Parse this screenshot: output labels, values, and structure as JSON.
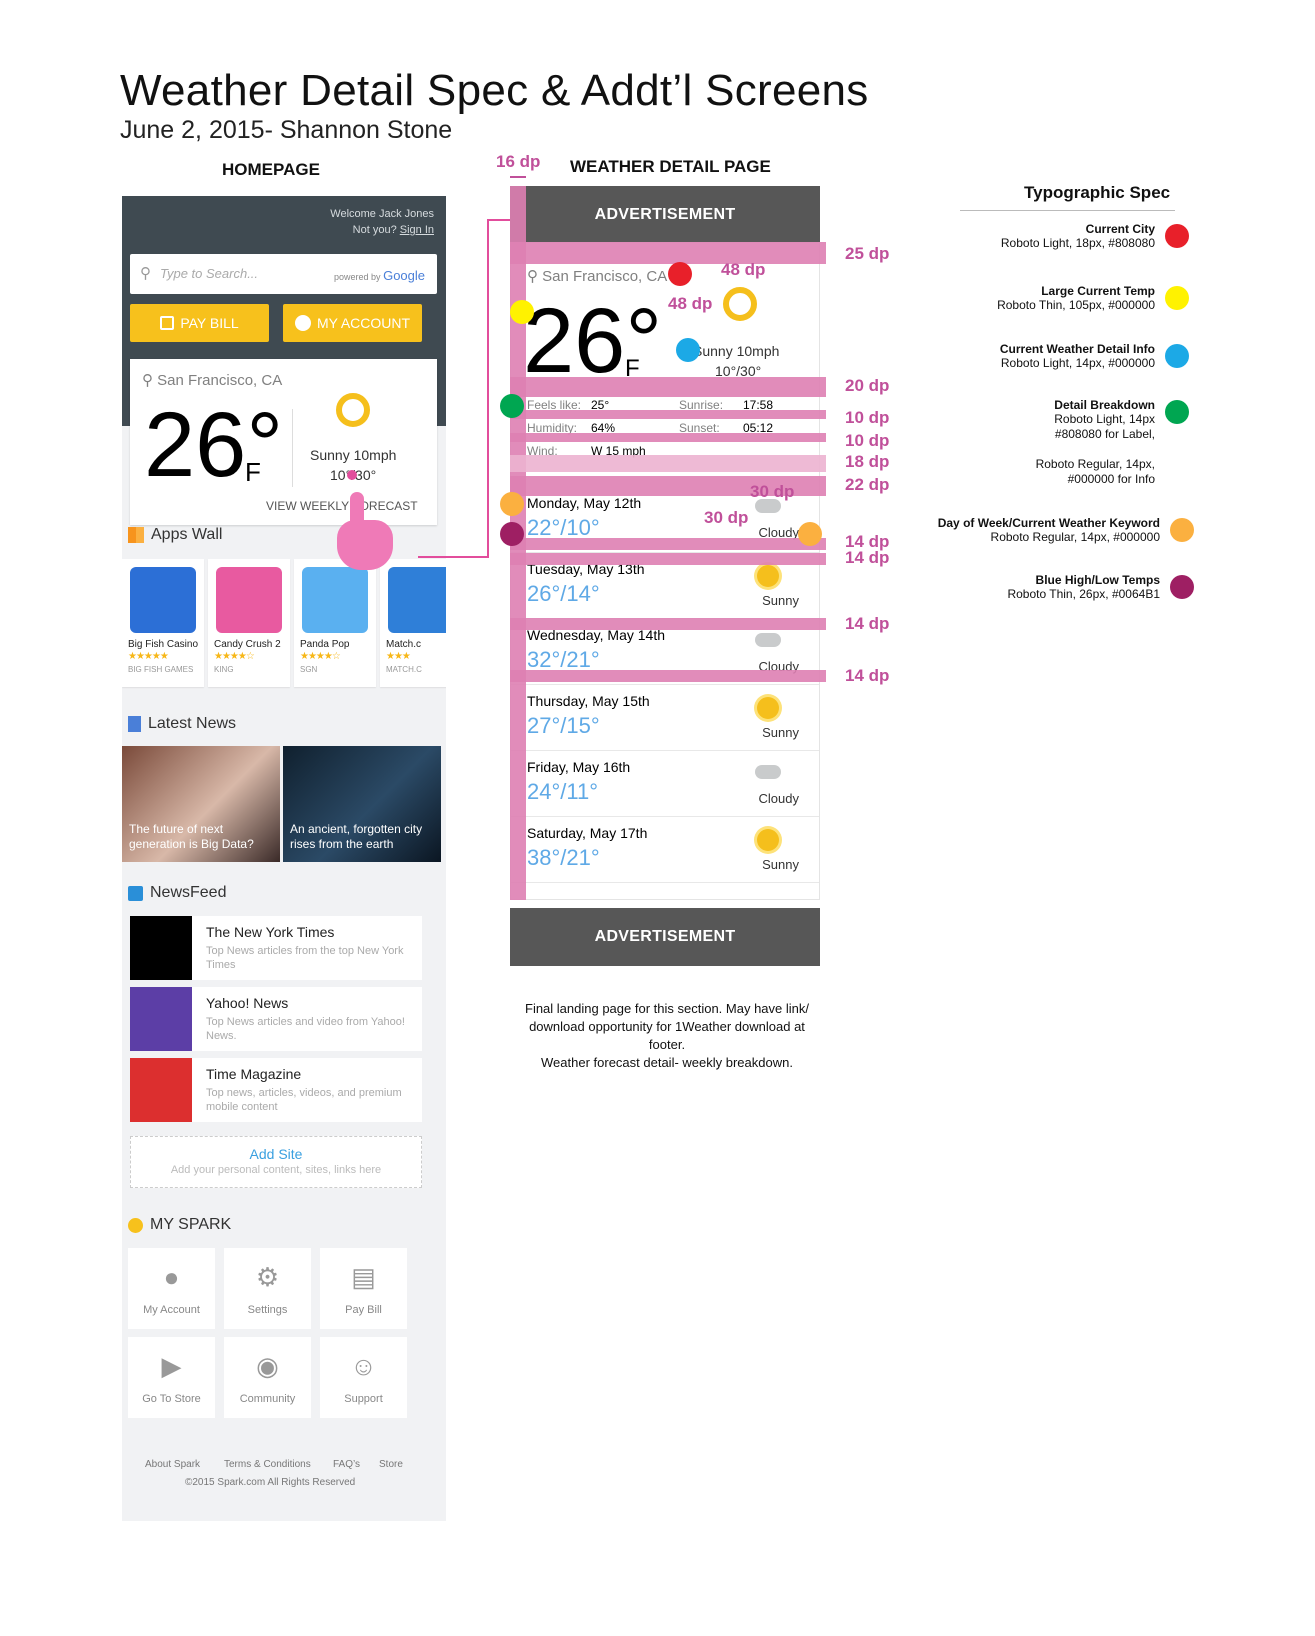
{
  "header": {
    "title": "Weather Detail Spec & Addt’l Screens",
    "subtitle": "June 2, 2015- Shannon Stone"
  },
  "homepage": {
    "section_title": "HOMEPAGE",
    "welcome_line1": "Welcome Jack Jones",
    "welcome_line2": "Not you?",
    "sign_in": "Sign In",
    "search_placeholder": "Type to Search...",
    "powered_by": "powered by",
    "google": "Google",
    "pay_bill": "PAY BILL",
    "my_account": "MY ACCOUNT",
    "weather": {
      "city": "San Francisco, CA",
      "temp": "26°",
      "unit": "F",
      "condition": "Sunny  10mph",
      "hilo": "10°/30°",
      "view_weekly": "VIEW WEEKLY FORECAST"
    },
    "apps_wall_title": "Apps Wall",
    "apps": [
      {
        "name": "Big Fish Casino",
        "stars": "★★★★★",
        "publisher": "BIG FISH GAMES",
        "color": "#2c6fd6"
      },
      {
        "name": "Candy Crush 2",
        "stars": "★★★★☆",
        "publisher": "KING",
        "color": "#e85aa0"
      },
      {
        "name": "Panda Pop",
        "stars": "★★★★☆",
        "publisher": "SGN",
        "color": "#5ab0f0"
      },
      {
        "name": "Match.c",
        "stars": "★★★",
        "publisher": "MATCH.C",
        "color": "#2f7fd8"
      }
    ],
    "latest_news_title": "Latest News",
    "news": [
      {
        "caption1": "The future of next",
        "caption2": "generation is Big Data?"
      },
      {
        "caption1": "An ancient, forgotten city",
        "caption2": "rises from the earth"
      }
    ],
    "newsfeed_title": "NewsFeed",
    "feeds": [
      {
        "title": "The New York Times",
        "desc": "Top News articles from the top New York Times",
        "color": "#000000"
      },
      {
        "title": "Yahoo! News",
        "desc": "Top News articles and video from Yahoo! News.",
        "color": "#5c3ea6"
      },
      {
        "title": "Time Magazine",
        "desc": "Top news, articles, videos, and premium mobile content",
        "color": "#dc2f2f"
      }
    ],
    "add_site": "Add Site",
    "add_site_desc": "Add your personal content, sites, links here",
    "my_spark_title": "MY SPARK",
    "spark_tiles": [
      {
        "label": "My Account",
        "icon": "person-icon"
      },
      {
        "label": "Settings",
        "icon": "gear-icon"
      },
      {
        "label": "Pay Bill",
        "icon": "bill-icon"
      },
      {
        "label": "Go To Store",
        "icon": "store-icon"
      },
      {
        "label": "Community",
        "icon": "community-icon"
      },
      {
        "label": "Support",
        "icon": "support-icon"
      }
    ],
    "footer_links": [
      "About Spark",
      "Terms & Conditions",
      "FAQ’s",
      "Store"
    ],
    "copyright": "©2015 Spark.com All Rights Reserved"
  },
  "detail": {
    "section_title": "WEATHER DETAIL PAGE",
    "ad_top": "ADVERTISEMENT",
    "ad_bottom": "ADVERTISEMENT",
    "city": "San Francisco, CA",
    "temp": "26°",
    "unit": "F",
    "condition": "Sunny  10mph",
    "hilo": "10°/30°",
    "details": {
      "feels_label": "Feels like:",
      "feels": "25°",
      "humidity_label": "Humidity:",
      "humidity": "64%",
      "wind_label": "Wind:",
      "wind": "W 15 mph",
      "sunrise_label": "Sunrise:",
      "sunrise": "17:58",
      "sunset_label": "Sunset:",
      "sunset": "05:12"
    },
    "days": [
      {
        "day": "Monday, May 12th",
        "temps": "22°/10°",
        "keyword": "Cloudy",
        "icon": "cloud-icon"
      },
      {
        "day": "Tuesday, May 13th",
        "temps": "26°/14°",
        "keyword": "Sunny",
        "icon": "sun-icon"
      },
      {
        "day": "Wednesday, May 14th",
        "temps": "32°/21°",
        "keyword": "Cloudy",
        "icon": "cloud-icon"
      },
      {
        "day": "Thursday, May 15th",
        "temps": "27°/15°",
        "keyword": "Sunny",
        "icon": "sun-icon"
      },
      {
        "day": "Friday, May 16th",
        "temps": "24°/11°",
        "keyword": "Cloudy",
        "icon": "cloud-icon"
      },
      {
        "day": "Saturday, May 17th",
        "temps": "38°/21°",
        "keyword": "Sunny",
        "icon": "sun-icon"
      }
    ],
    "measures": {
      "m16": "16 dp",
      "m25": "25 dp",
      "m48a": "48 dp",
      "m48b": "48 dp",
      "m20": "20 dp",
      "m10a": "10 dp",
      "m10b": "10 dp",
      "m18": "18 dp",
      "m22": "22 dp",
      "m30a": "30 dp",
      "m30b": "30 dp",
      "m14a": "14 dp",
      "m14b": "14 dp",
      "m14c": "14 dp",
      "m14d": "14 dp"
    },
    "note_lines": [
      "Final landing page for this section. May have link/",
      "download opportunity for 1Weather download at",
      "footer.",
      "Weather forecast detail- weekly breakdown."
    ]
  },
  "typo_spec": {
    "title": "Typographic Spec",
    "items": [
      {
        "name": "Current City",
        "desc": [
          "Roboto Light, 18px, #808080"
        ],
        "color": "#e8202a"
      },
      {
        "name": "Large Current Temp",
        "desc": [
          "Roboto Thin, 105px, #000000"
        ],
        "color": "#fff200"
      },
      {
        "name": "Current Weather Detail Info",
        "desc": [
          "Roboto Light, 14px, #000000"
        ],
        "color": "#1ca9e6"
      },
      {
        "name": "Detail Breakdown",
        "desc": [
          "Roboto Light, 14px",
          "#808080 for Label,",
          "",
          "Roboto Regular, 14px,",
          "#000000 for Info"
        ],
        "color": "#00a651"
      },
      {
        "name": "Day of Week/Current Weather Keyword",
        "desc": [
          "Roboto Regular, 14px, #000000"
        ],
        "color": "#fbb040"
      },
      {
        "name": "Blue High/Low Temps",
        "desc": [
          "Roboto Thin, 26px, #0064B1"
        ],
        "color": "#9e1f63"
      }
    ]
  },
  "colors": {
    "accent_yellow": "#f7c11c",
    "header_dark": "#3f4a51",
    "ad_gray": "#575757",
    "spec_pink": "#de7fb2",
    "temp_blue": "#5fa9e6"
  }
}
